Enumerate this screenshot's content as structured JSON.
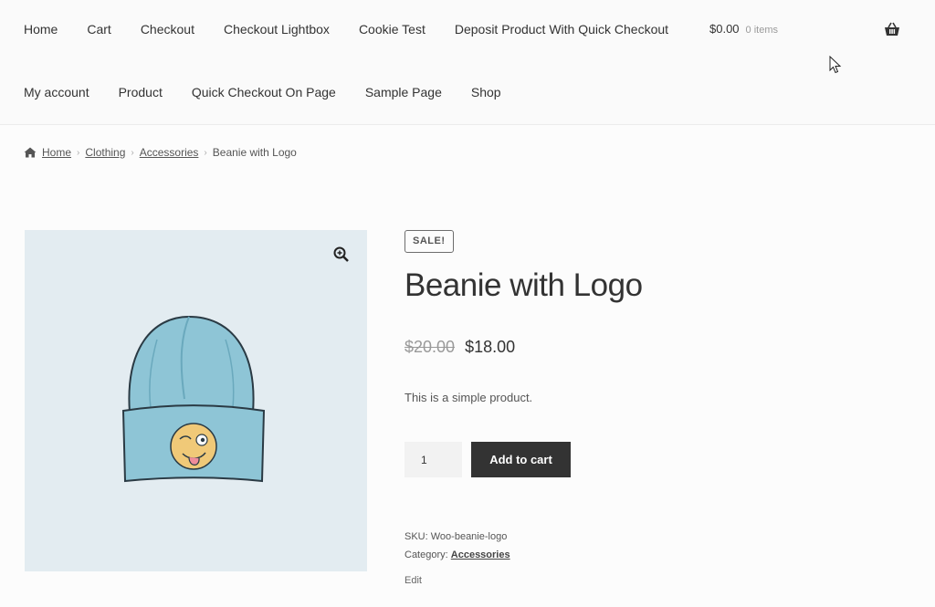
{
  "nav": {
    "row1": [
      "Home",
      "Cart",
      "Checkout",
      "Checkout Lightbox",
      "Cookie Test",
      "Deposit Product With Quick Checkout"
    ],
    "row2": [
      "My account",
      "Product",
      "Quick Checkout On Page",
      "Sample Page",
      "Shop"
    ]
  },
  "mini_cart": {
    "amount": "$0.00",
    "count": "0 items"
  },
  "breadcrumb": {
    "home": "Home",
    "clothing": "Clothing",
    "accessories": "Accessories",
    "current": "Beanie with Logo"
  },
  "product": {
    "badge": "SALE!",
    "title": "Beanie with Logo",
    "price_old": "$20.00",
    "price_new": "$18.00",
    "description": "This is a simple product.",
    "quantity": "1",
    "add_to_cart_label": "Add to cart",
    "sku_label": "SKU:",
    "sku_value": "Woo-beanie-logo",
    "category_label": "Category:",
    "category_value": "Accessories",
    "edit_label": "Edit"
  },
  "colors": {
    "button_bg": "#333333",
    "image_bg": "#e3ecf1",
    "beanie": "#8ec5d6"
  },
  "icons": [
    "basket-icon",
    "home-icon",
    "zoom-icon",
    "cursor-icon"
  ]
}
